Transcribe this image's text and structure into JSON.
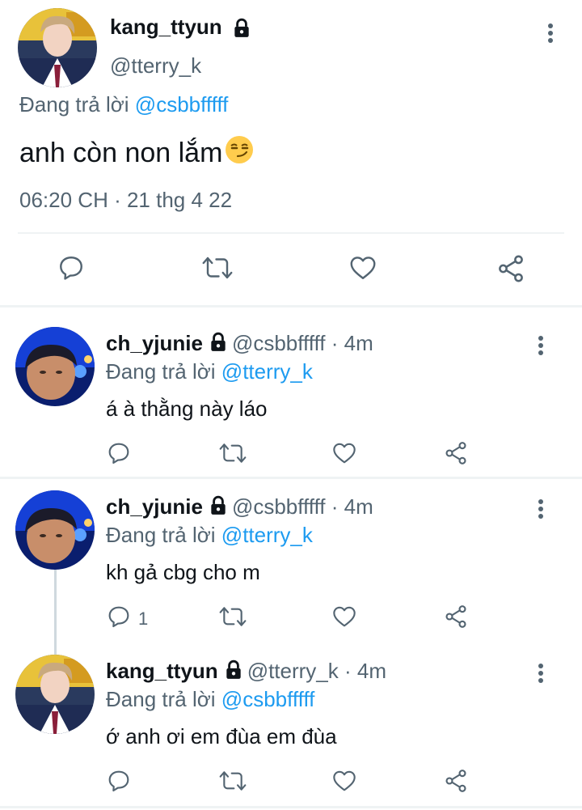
{
  "main_tweet": {
    "display_name": "kang_ttyun",
    "handle": "@tterry_k",
    "replying_prefix": "Đang trả lời",
    "replying_to": "@csbbfffff",
    "text": "anh còn non lắm",
    "emoji": "😏",
    "timestamp": "06:20 CH · 21 thg 4 22",
    "icons": [
      "lock-icon",
      "more-icon",
      "reply-icon",
      "retweet-icon",
      "like-icon",
      "share-icon"
    ]
  },
  "replies": [
    {
      "display_name": "ch_yjunie",
      "handle": "@csbbfffff",
      "separator": "·",
      "age": "4m",
      "replying_prefix": "Đang trả lời",
      "replying_to": "@tterry_k",
      "text": "á à thằng này láo",
      "reply_count": ""
    },
    {
      "display_name": "ch_yjunie",
      "handle": "@csbbfffff",
      "separator": "·",
      "age": "4m",
      "replying_prefix": "Đang trả lời",
      "replying_to": "@tterry_k",
      "text": "kh gả cbg cho m",
      "reply_count": "1"
    },
    {
      "display_name": "kang_ttyun",
      "handle": "@tterry_k",
      "separator": "·",
      "age": "4m",
      "replying_prefix": "Đang trả lời",
      "replying_to": "@csbbfffff",
      "text": "ớ anh ơi em đùa em đùa",
      "reply_count": ""
    }
  ],
  "colors": {
    "text": "#0f1419",
    "secondary": "#536471",
    "link": "#1d9bf0",
    "divider": "#eff3f4"
  }
}
